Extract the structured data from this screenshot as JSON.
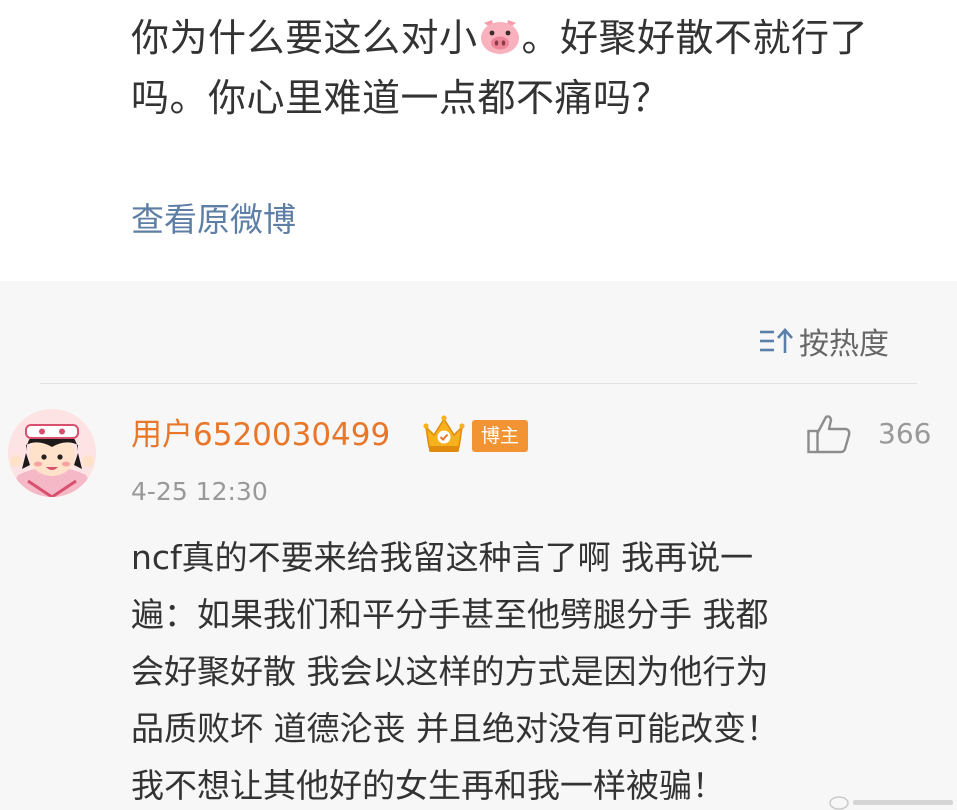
{
  "post": {
    "text_before_emoji": "你为什么要这么对小",
    "emoji": "pig-face",
    "text_after_emoji": "。好聚好散不就行了吗。你心里难道一点都不痛吗？",
    "view_original_label": "查看原微博"
  },
  "comments_header": {
    "sort_label": "按热度",
    "sort_icon": "sort-icon"
  },
  "comment": {
    "username": "用户6520030499",
    "crown_icon": "crown-icon",
    "badge": "博主",
    "like_icon": "thumb-up-icon",
    "like_count": "366",
    "timestamp": "4-25 12:30",
    "lines": [
      "ncf真的不要来给我留这种言了啊 我再说一",
      "遍：如果我们和平分手甚至他劈腿分手 我都",
      "会好聚好散 我会以这样的方式是因为他行为",
      "品质败坏 道德沦丧 并且绝对没有可能改变！",
      "我不想让其他好的女生再和我一样被骗！"
    ]
  },
  "colors": {
    "username": "#e97729",
    "badge_bg": "#f29433",
    "link": "#5d7ea5",
    "body_text": "#333333",
    "meta_text": "#999999",
    "background": "#f7f7f7"
  }
}
